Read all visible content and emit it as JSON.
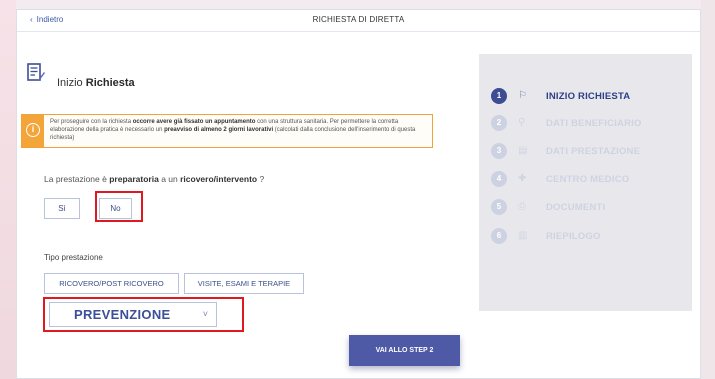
{
  "header": {
    "back_label": "Indietro",
    "title": "RICHIESTA DI DIRETTA"
  },
  "section": {
    "title_plain": "Inizio",
    "title_bold": "Richiesta",
    "icon": "edit-document-icon"
  },
  "notice": {
    "icon": "info-icon",
    "icon_glyph": "i",
    "parts": [
      "Per proseguire con la richiesta ",
      "occorre avere già fissato un appuntamento",
      " con una struttura sanitaria. Per permettere la corretta elaborazione della pratica è necessario un ",
      "preavviso di almeno 2 giorni lavorativi",
      " (calcolati dalla conclusione dell'inserimento di questa richiesta)"
    ]
  },
  "question": {
    "parts": [
      "La prestazione è ",
      "preparatoria",
      " a un ",
      "ricovero/intervento",
      " ?"
    ],
    "yes_label": "Sì",
    "no_label": "No"
  },
  "tipo": {
    "label": "Tipo prestazione",
    "options": [
      "RICOVERO/POST RICOVERO",
      "VISITE, ESAMI E TERAPIE"
    ],
    "selected": "PREVENZIONE",
    "chevron": "˅"
  },
  "next_button": "VAI ALLO STEP 2",
  "steps": [
    {
      "num": "1",
      "label": "INIZIO RICHIESTA",
      "icon": "flag-icon",
      "glyph": "⚐",
      "active": true
    },
    {
      "num": "2",
      "label": "DATI BENEFICIARIO",
      "icon": "person-icon",
      "glyph": "⚲",
      "active": false
    },
    {
      "num": "3",
      "label": "DATI PRESTAZIONE",
      "icon": "document-icon",
      "glyph": "▤",
      "active": false
    },
    {
      "num": "4",
      "label": "CENTRO MEDICO",
      "icon": "medical-cross-icon",
      "glyph": "✚",
      "active": false
    },
    {
      "num": "5",
      "label": "DOCUMENTI",
      "icon": "documents-icon",
      "glyph": "⎙",
      "active": false
    },
    {
      "num": "6",
      "label": "RIEPILOGO",
      "icon": "summary-icon",
      "glyph": "▥",
      "active": false
    }
  ],
  "colors": {
    "primary": "#4f5aa6",
    "highlight": "#e0181f",
    "warning": "#f4a53a",
    "active_step": "#3c4d94"
  }
}
